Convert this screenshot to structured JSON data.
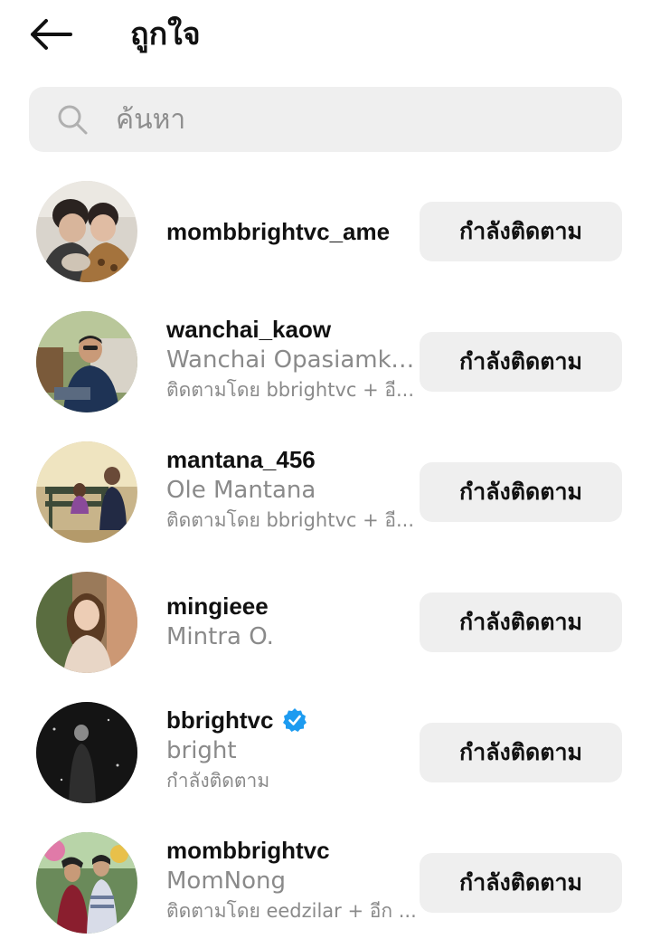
{
  "header": {
    "title": "ถูกใจ",
    "back_icon": "arrow-left-icon"
  },
  "search": {
    "placeholder": "ค้นหา",
    "icon": "search-icon"
  },
  "colors": {
    "button_bg": "#efefef",
    "secondary_text": "#8a8a8a",
    "verified": "#1d9bf0"
  },
  "users": [
    {
      "username": "mombbrightvc_ame",
      "fullname": "",
      "subtext": "",
      "verified": false,
      "button": "กำลังติดตาม"
    },
    {
      "username": "wanchai_kaow",
      "fullname": "Wanchai Opasiamkaj...",
      "subtext": "ติดตามโดย bbrightvc + อี...",
      "verified": false,
      "button": "กำลังติดตาม"
    },
    {
      "username": "mantana_456",
      "fullname": "Ole Mantana",
      "subtext": "ติดตามโดย bbrightvc + อี...",
      "verified": false,
      "button": "กำลังติดตาม"
    },
    {
      "username": "mingieee",
      "fullname": "Mintra O.",
      "subtext": "",
      "verified": false,
      "button": "กำลังติดตาม"
    },
    {
      "username": "bbrightvc",
      "fullname": "bright",
      "subtext": "กำลังติดตาม",
      "verified": true,
      "button": "กำลังติดตาม"
    },
    {
      "username": "mombbrightvc",
      "fullname": "MomNong",
      "subtext": "ติดตามโดย eedzilar + อีก ...",
      "verified": false,
      "button": "กำลังติดตาม"
    }
  ]
}
